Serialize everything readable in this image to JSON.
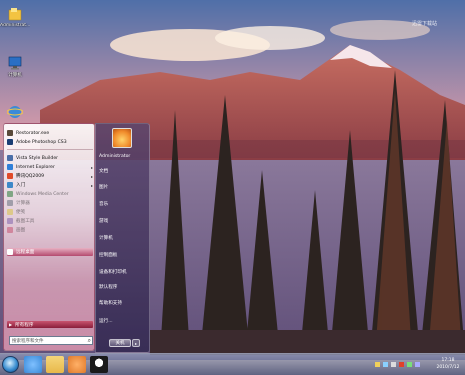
{
  "desktop": {
    "icons": [
      {
        "name": "administrator-folder-icon",
        "label": "Administrat..."
      },
      {
        "name": "computer-icon",
        "label": "计算机"
      },
      {
        "name": "ie-icon",
        "label": ""
      }
    ],
    "watermark": "迅雷下载站"
  },
  "start_menu": {
    "pinned": [
      {
        "label": "Restorator.exe",
        "color": "#5a4a3a"
      },
      {
        "label": "Adobe Photoshop CS3",
        "color": "#1b3f74"
      }
    ],
    "recent": [
      {
        "label": "Vista Style Builder",
        "color": "#4b6fa8",
        "arrow": ""
      },
      {
        "label": "Internet Explorer",
        "color": "#2f7fd8",
        "arrow": "▸"
      },
      {
        "label": "腾讯QQ2009",
        "color": "#e04a2a",
        "arrow": "▸"
      },
      {
        "label": "入门",
        "color": "#3d88c8",
        "arrow": "▸"
      },
      {
        "label": "Windows Media Center",
        "color": "#2c7d3a",
        "arrow": ""
      },
      {
        "label": "计算器",
        "color": "#5d6775",
        "arrow": ""
      },
      {
        "label": "便笺",
        "color": "#d8c23a",
        "arrow": ""
      },
      {
        "label": "截图工具",
        "color": "#7a5aa8",
        "arrow": ""
      },
      {
        "label": "画图",
        "color": "#c54a6a",
        "arrow": ""
      }
    ],
    "highlighted": "远程桌面",
    "all_programs": "所有程序",
    "search_placeholder": "搜索程序和文件",
    "user_name": "Administrator",
    "right_items": [
      "文档",
      "图片",
      "音乐",
      "游戏",
      "计算机",
      "控制面板",
      "设备和打印机",
      "默认程序",
      "帮助和支持",
      "运行..."
    ],
    "shutdown_label": "关机"
  },
  "taskbar": {
    "pinned": [
      {
        "name": "ie-taskbar-icon",
        "color": "#3a8ad8"
      },
      {
        "name": "explorer-taskbar-icon",
        "color": "#e8b84a"
      },
      {
        "name": "media-player-taskbar-icon",
        "color": "#e07a2a"
      },
      {
        "name": "qq-taskbar-icon",
        "color": "#1a1a1a"
      }
    ],
    "time": "17:18",
    "date": "2010/7/12"
  }
}
